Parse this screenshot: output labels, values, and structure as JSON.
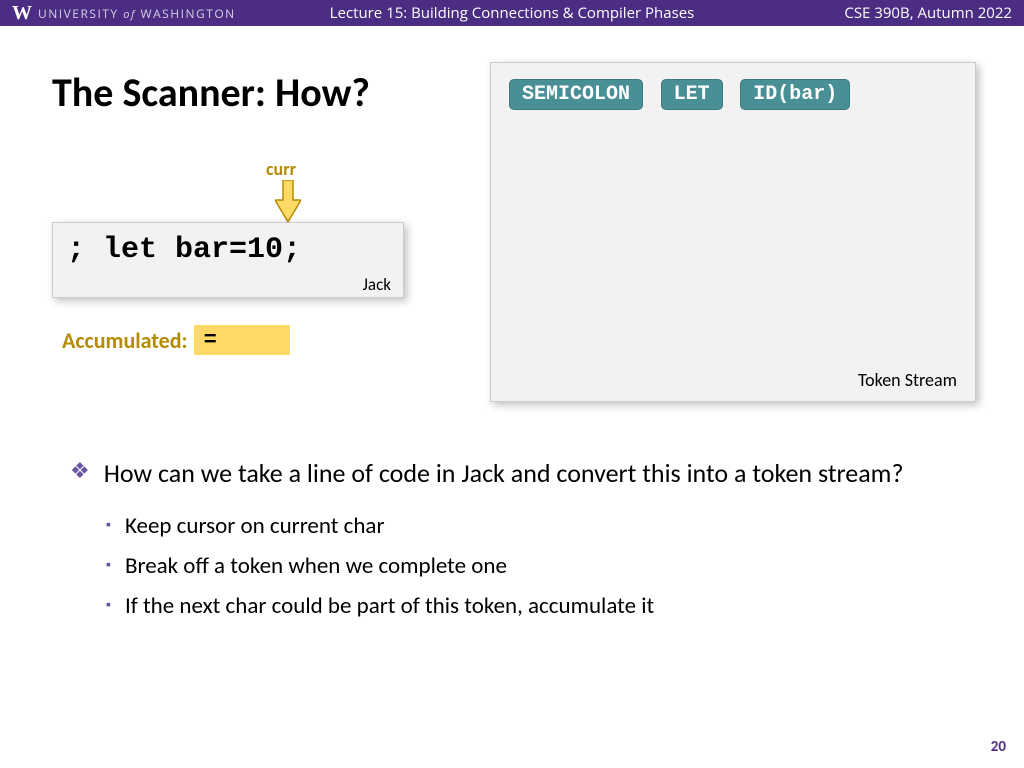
{
  "header": {
    "logo": "W",
    "university": "UNIVERSITY",
    "of": "of",
    "washington": "WASHINGTON",
    "lecture": "Lecture 15: Building Connections & Compiler Phases",
    "course": "CSE 390B, Autumn 2022"
  },
  "title": "The Scanner: How?",
  "curr_label": "curr",
  "code": {
    "text": "; let bar=10;",
    "lang": "Jack"
  },
  "accumulated": {
    "label": "Accumulated:",
    "value": "="
  },
  "tokens": {
    "items": [
      "SEMICOLON",
      "LET",
      "ID(bar)"
    ],
    "panel_label": "Token Stream"
  },
  "bullets": {
    "main": "How can we take a line of code in Jack and convert this into a token stream?",
    "subs": [
      "Keep cursor on current char",
      "Break off a token when we complete one",
      "If the next char could be part of this token, accumulate it"
    ]
  },
  "page_number": "20"
}
